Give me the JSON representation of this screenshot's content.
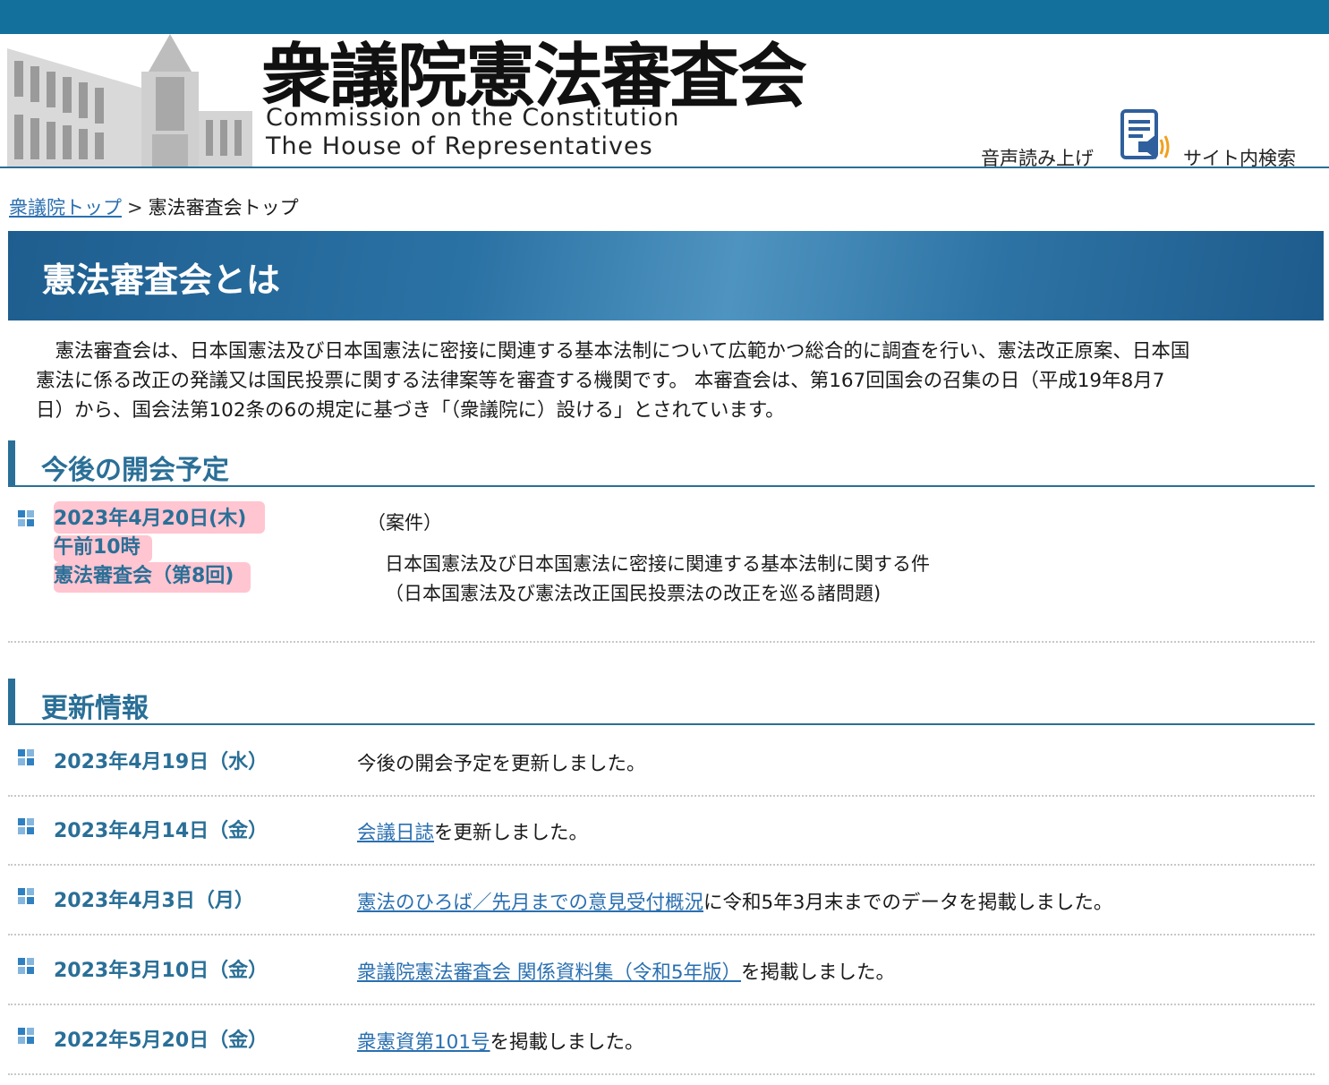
{
  "header": {
    "title_jp": "衆議院憲法審査会",
    "title_en_line1": "Commission on the Constitution",
    "title_en_line2": "The House of  Representatives",
    "voice_label": "音声読み上げ",
    "search_label": "サイト内検索"
  },
  "breadcrumb": {
    "home_link": "衆議院トップ",
    "separator": ">",
    "current": "憲法審査会トップ"
  },
  "hero": {
    "title": "憲法審査会とは"
  },
  "intro": {
    "lines": [
      "　憲法審査会は、日本国憲法及び日本国憲法に密接に関連する基本法制について広範かつ総合的に調査を行い、憲法改正原案、日本国",
      "憲法に係る改正の発議又は国民投票に関する法律案等を審査する機関です。 本審査会は、第167回国会の召集の日（平成19年8月7",
      "日）から、国会法第102条の6の規定に基づき「（衆議院に）設ける」とされています。"
    ]
  },
  "schedule": {
    "heading": "今後の開会予定",
    "date": "2023年4月20日(木)",
    "time": "午前10時",
    "meeting": "憲法審査会（第8回)",
    "case_label": "（案件）",
    "case_line1": "日本国憲法及び日本国憲法に密接に関連する基本法制に関する件",
    "case_line2": "（日本国憲法及び憲法改正国民投票法の改正を巡る諸問題)"
  },
  "updates": {
    "heading": "更新情報",
    "items": [
      {
        "date": "2023年4月19日（水）",
        "link": "",
        "text": "今後の開会予定を更新しました。"
      },
      {
        "date": "2023年4月14日（金）",
        "link": "会議日誌",
        "text": "を更新しました。"
      },
      {
        "date": "2023年4月3日（月）",
        "link": "憲法のひろば／先月までの意見受付概況",
        "text": "に令和5年3月末までのデータを掲載しました。"
      },
      {
        "date": "2023年3月10日（金）",
        "link": "衆議院憲法審査会 関係資料集（令和5年版）",
        "text": "を掲載しました。"
      },
      {
        "date": "2022年5月20日（金）",
        "link": "衆憲資第101号",
        "text": "を掲載しました。"
      }
    ]
  }
}
